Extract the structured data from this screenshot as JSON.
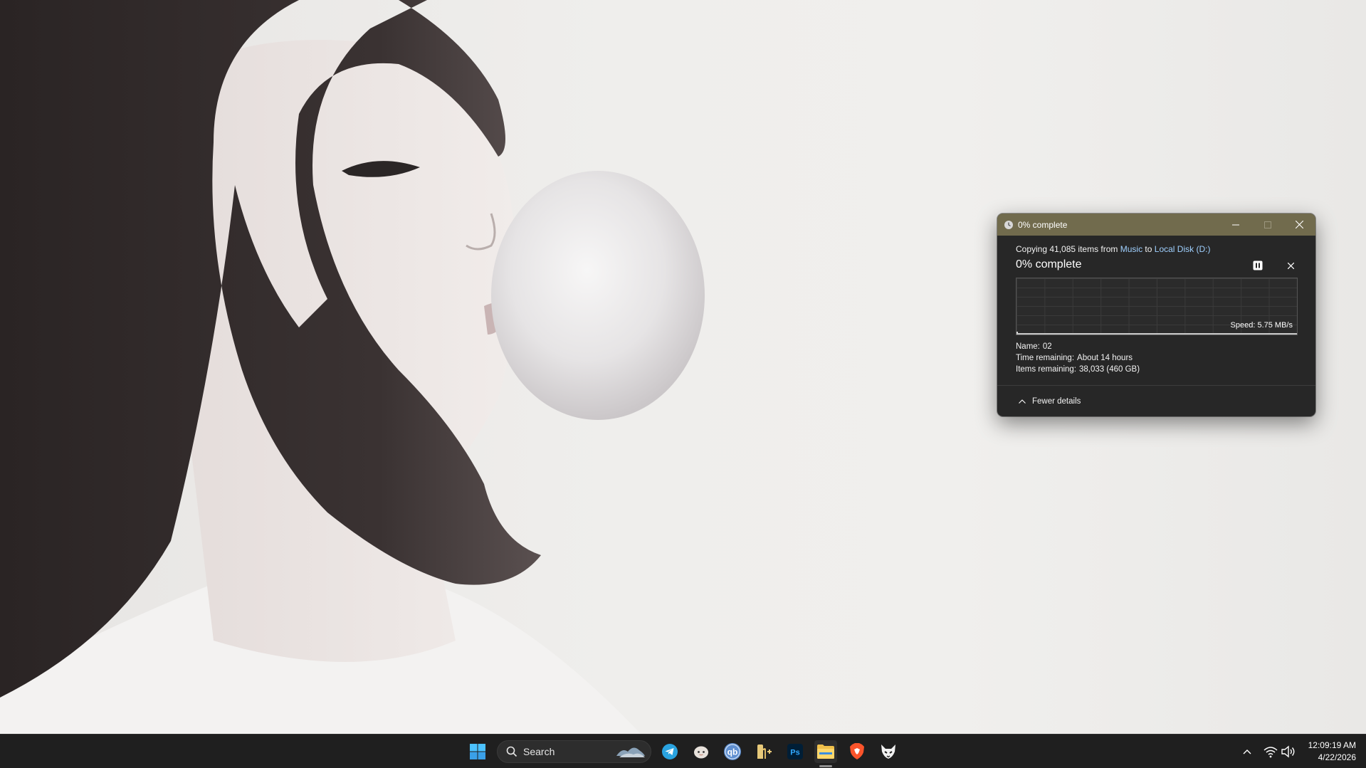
{
  "dialog": {
    "window_title": "0% complete",
    "copy_prefix": "Copying 41,085 items from ",
    "source": "Music",
    "copy_mid": " to ",
    "destination": "Local Disk (D:)",
    "progress_title": "0% complete",
    "progress_percent": 0,
    "speed": "Speed: 5.75 MB/s",
    "name_label": "Name:",
    "name_value": "02",
    "time_label": "Time remaining:",
    "time_value": "About 14 hours",
    "items_label": "Items remaining:",
    "items_value": "38,033 (460 GB)",
    "fewer_details": "Fewer details",
    "titlebar_color": "#716b4d",
    "link_color": "#9fd0ff"
  },
  "taskbar": {
    "search_label": "Search",
    "apps": [
      "windows-start-icon",
      "telegram-icon",
      "bot-face-icon",
      "qbittorrent-icon",
      "notepad-plus-icon",
      "photoshop-icon",
      "file-explorer-icon",
      "brave-icon",
      "vpn-fox-icon"
    ],
    "photoshop_text": "Ps",
    "qbittorrent_text": "qb"
  },
  "clock": {
    "time": "12:09:19 AM",
    "date": "4/22/2026"
  }
}
